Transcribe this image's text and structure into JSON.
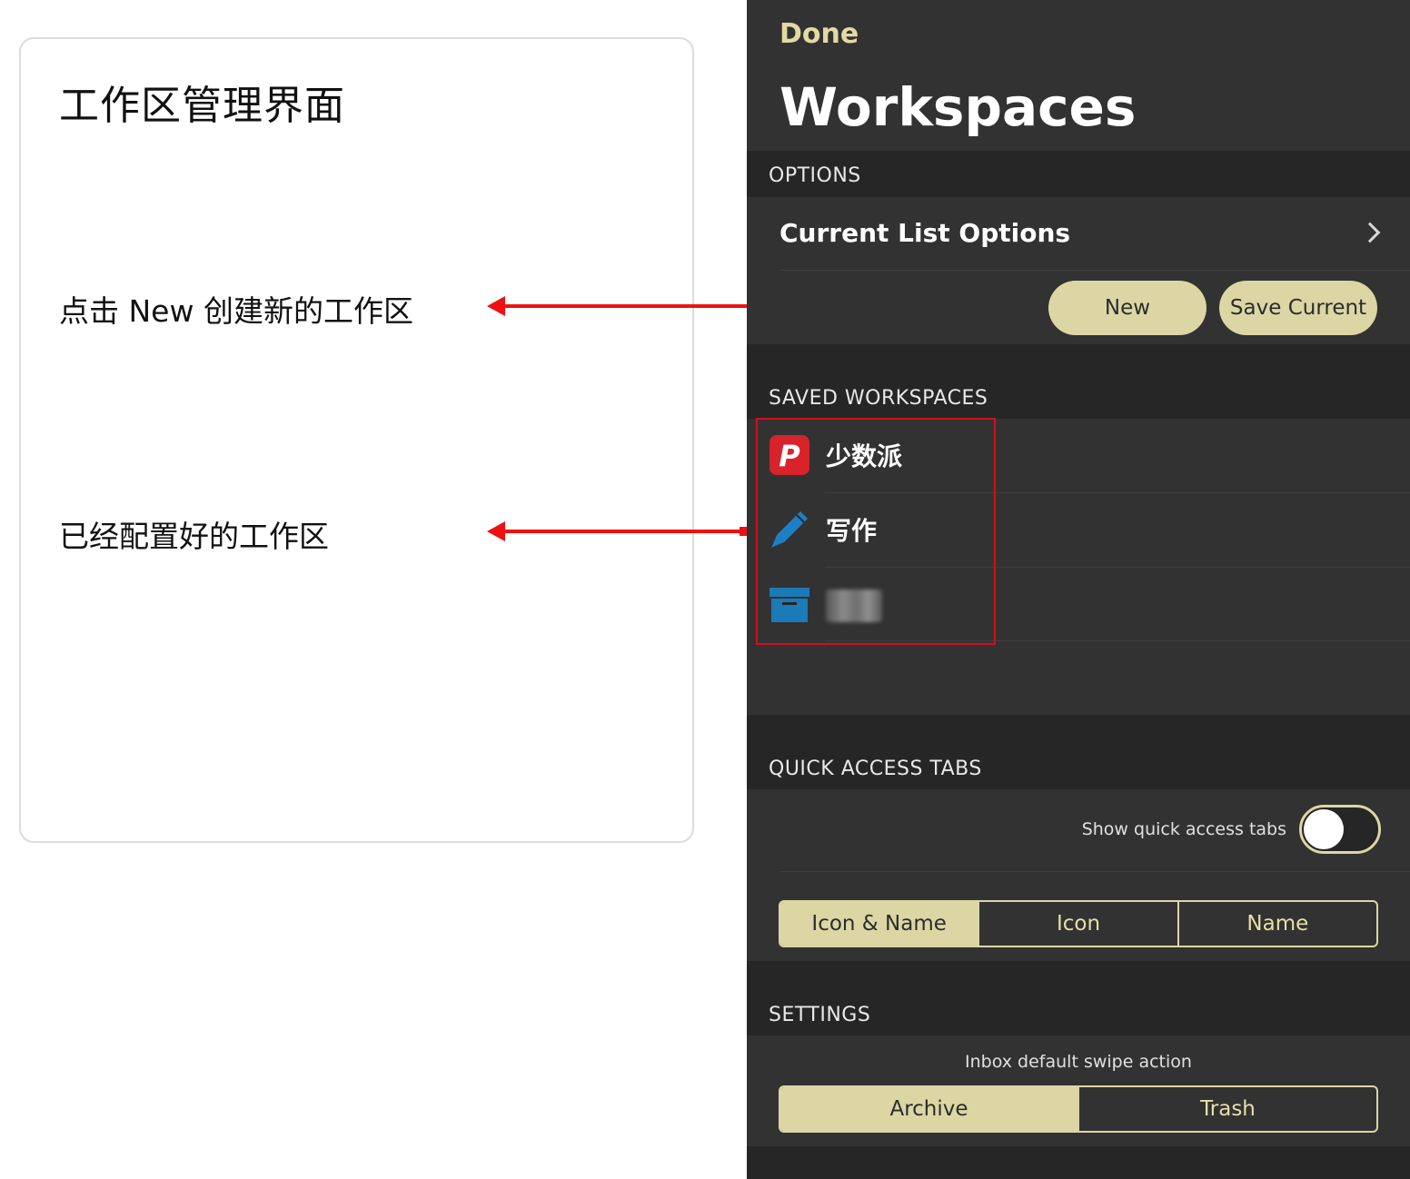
{
  "annotations": {
    "card_title": "工作区管理界面",
    "new_hint": "点击 New 创建新的工作区",
    "saved_hint": "已经配置好的工作区"
  },
  "colors": {
    "accent": "#dcd6a5",
    "done_text": "#e3d9a4",
    "annotation_red": "#ee1111",
    "panel_bg": "#262626"
  },
  "nav": {
    "done_label": "Done",
    "title": "Workspaces"
  },
  "options": {
    "header": "OPTIONS",
    "current_list_options": "Current List Options",
    "new_label": "New",
    "save_current_label": "Save Current"
  },
  "saved_workspaces": {
    "header": "SAVED WORKSPACES",
    "items": [
      {
        "name": "少数派",
        "icon": "sspai-p-icon"
      },
      {
        "name": "写作",
        "icon": "pen-icon"
      },
      {
        "name": "",
        "icon": "archive-box-icon"
      }
    ]
  },
  "quick_access": {
    "header": "QUICK ACCESS TABS",
    "toggle_label": "Show quick access tabs",
    "toggle_on": false,
    "display_modes": [
      "Icon & Name",
      "Icon",
      "Name"
    ],
    "selected_mode": "Icon & Name"
  },
  "settings": {
    "header": "SETTINGS",
    "swipe_caption": "Inbox default swipe action",
    "swipe_options": [
      "Archive",
      "Trash"
    ],
    "selected_swipe": "Archive"
  }
}
